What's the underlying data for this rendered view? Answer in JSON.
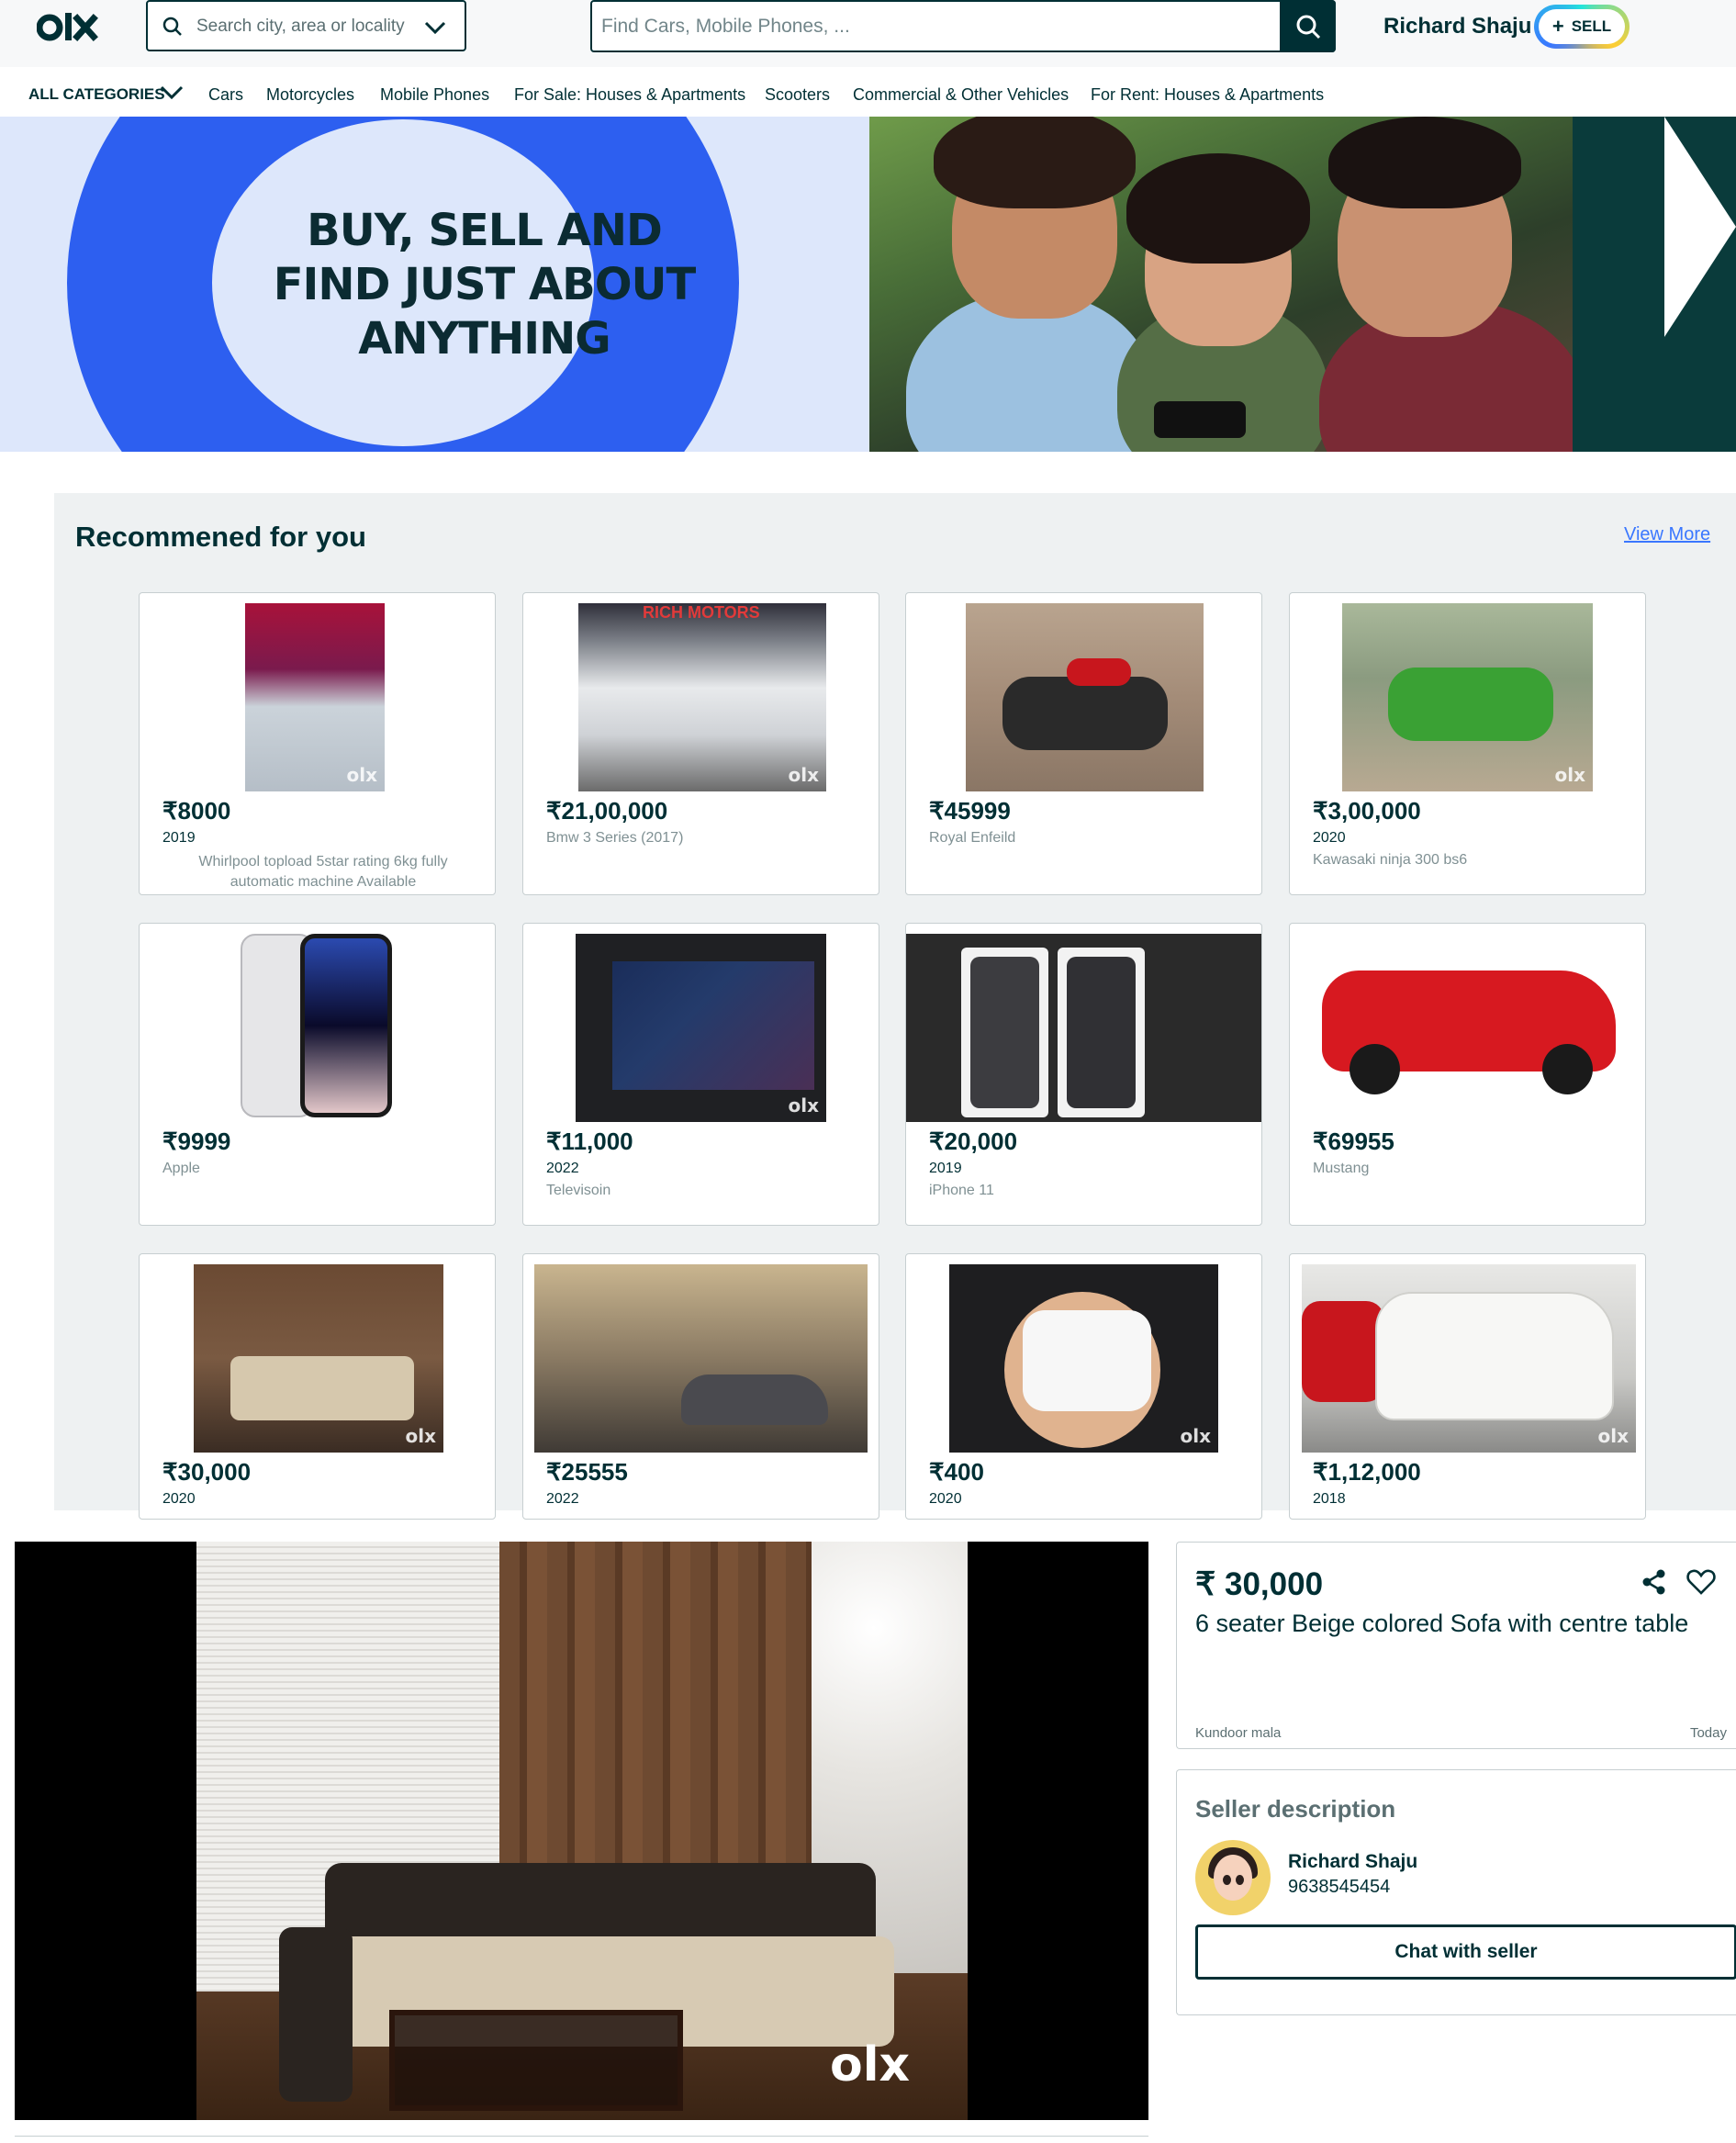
{
  "header": {
    "location_placeholder": "Search city, area or locality",
    "search_placeholder": "Find Cars, Mobile Phones, ...",
    "user_name": "Richard Shaju",
    "sell_label": "SELL",
    "sell_plus": "+"
  },
  "categories": {
    "all_label": "ALL CATEGORIES",
    "items": [
      "Cars",
      "Motorcycles",
      "Mobile Phones",
      "For Sale: Houses & Apartments",
      "Scooters",
      "Commercial & Other Vehicles",
      "For Rent: Houses & Apartments"
    ]
  },
  "banner": {
    "line1": "BUY, SELL AND",
    "line2": "FIND JUST ABOUT",
    "line3": "ANYTHING"
  },
  "recommended": {
    "title": "Recommened for you",
    "view_more": "View More",
    "cards": [
      {
        "price": "₹8000",
        "year": "2019",
        "desc": "Whirlpool topload 5star rating 6kg fully automatic machine Available"
      },
      {
        "price": "₹21,00,000",
        "year": "",
        "desc": "Bmw 3 Series (2017)"
      },
      {
        "price": "₹45999",
        "year": "",
        "desc": "Royal Enfeild"
      },
      {
        "price": "₹3,00,000",
        "year": "2020",
        "desc": "Kawasaki ninja 300 bs6"
      },
      {
        "price": "₹9999",
        "year": "",
        "desc": "Apple"
      },
      {
        "price": "₹11,000",
        "year": "2022",
        "desc": "Televisoin"
      },
      {
        "price": "₹20,000",
        "year": "2019",
        "desc": "iPhone 11"
      },
      {
        "price": "₹69955",
        "year": "",
        "desc": "Mustang"
      },
      {
        "price": "₹30,000",
        "year": "2020",
        "desc": ""
      },
      {
        "price": "₹25555",
        "year": "2022",
        "desc": ""
      },
      {
        "price": "₹400",
        "year": "2020",
        "desc": ""
      },
      {
        "price": "₹1,12,000",
        "year": "2018",
        "desc": ""
      }
    ],
    "image_text": {
      "rich_motors": "RICH MOTORS",
      "watermark": "olx"
    }
  },
  "listing": {
    "price": "₹ 30,000",
    "title": "6 seater Beige colored Sofa with centre table",
    "location": "Kundoor mala",
    "date": "Today",
    "watermark": "olx"
  },
  "seller": {
    "heading": "Seller description",
    "name": "Richard Shaju",
    "phone": "9638545454",
    "chat_label": "Chat with seller"
  },
  "colors": {
    "brand_dark": "#002f34",
    "link": "#3a77ff",
    "banner_blue": "#2d5ff0"
  },
  "icons": [
    "olx-logo",
    "search-icon",
    "chevron-down-icon",
    "share-icon",
    "heart-icon"
  ]
}
